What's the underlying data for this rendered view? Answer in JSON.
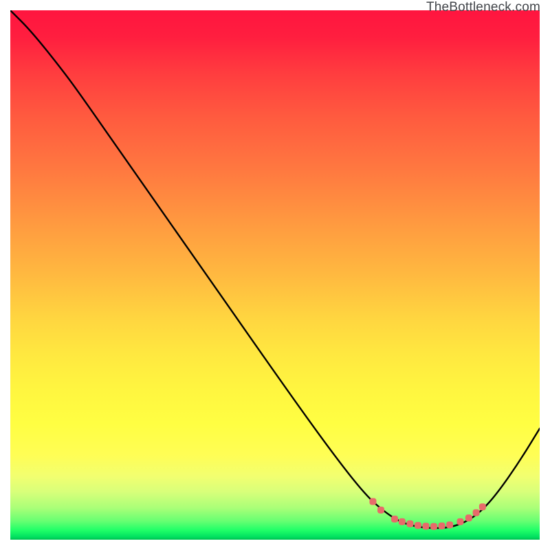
{
  "watermark": "TheBottleneck.com",
  "chart_data": {
    "type": "line",
    "title": "",
    "xlabel": "",
    "ylabel": "",
    "xlim": [
      0,
      100
    ],
    "ylim": [
      0,
      100
    ],
    "series": [
      {
        "name": "curve",
        "color": "#000000",
        "points": [
          [
            0,
            100
          ],
          [
            4,
            96
          ],
          [
            10,
            88.5
          ],
          [
            14,
            83
          ],
          [
            22,
            71.5
          ],
          [
            35,
            53
          ],
          [
            50,
            31.5
          ],
          [
            60,
            17.5
          ],
          [
            67,
            8.5
          ],
          [
            71,
            5
          ],
          [
            74,
            3.2
          ],
          [
            77,
            2.4
          ],
          [
            80,
            2.15
          ],
          [
            83,
            2.3
          ],
          [
            86,
            3.3
          ],
          [
            89,
            5.4
          ],
          [
            92,
            8.8
          ],
          [
            96,
            14.5
          ],
          [
            100,
            21
          ]
        ]
      },
      {
        "name": "highlight-dots",
        "color": "#e86a6a",
        "points": [
          [
            68.5,
            7.2
          ],
          [
            70.0,
            5.6
          ],
          [
            72.6,
            3.9
          ],
          [
            74.0,
            3.4
          ],
          [
            75.5,
            3.0
          ],
          [
            77.0,
            2.7
          ],
          [
            78.5,
            2.55
          ],
          [
            80.0,
            2.5
          ],
          [
            81.5,
            2.6
          ],
          [
            83.0,
            2.8
          ],
          [
            85.0,
            3.4
          ],
          [
            86.6,
            4.1
          ],
          [
            88.0,
            5.1
          ],
          [
            89.2,
            6.2
          ]
        ]
      }
    ]
  }
}
